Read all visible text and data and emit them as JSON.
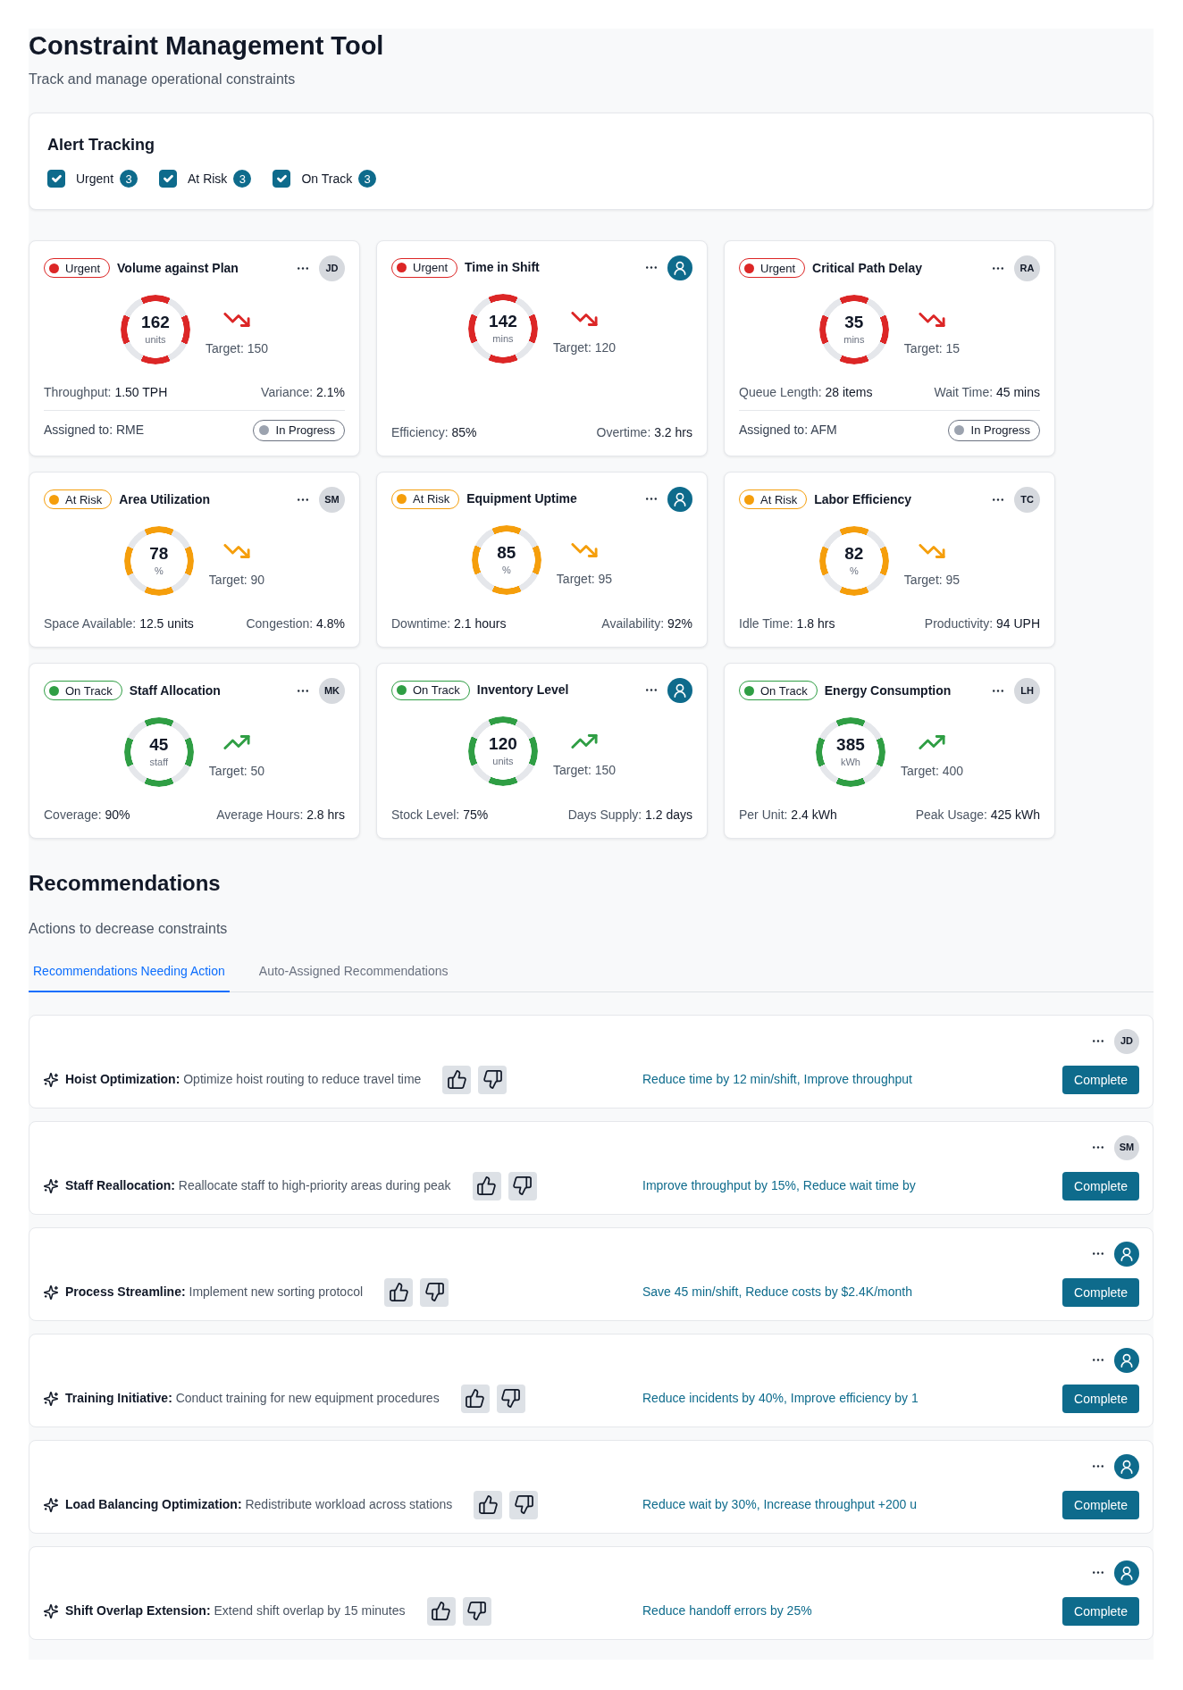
{
  "header": {
    "title": "Constraint Management Tool",
    "subtitle": "Track and manage operational constraints"
  },
  "alert_tracking": {
    "title": "Alert Tracking",
    "filters": [
      {
        "label": "Urgent",
        "checked": true,
        "count": "3"
      },
      {
        "label": "At Risk",
        "checked": true,
        "count": "3"
      },
      {
        "label": "On Track",
        "checked": true,
        "count": "3"
      }
    ]
  },
  "metric_cards": [
    {
      "status": {
        "label": "Urgent",
        "color": "#dc2626"
      },
      "title": "Volume against Plan",
      "assignee": {
        "kind": "initials",
        "initials": "JD"
      },
      "value": "162",
      "unit": "units",
      "trend": {
        "kind": "down"
      },
      "target": "Target: 150",
      "stats": [
        "Throughput: **1.50 TPH**",
        "Variance: **2.1%**"
      ],
      "assignment": {
        "text": "Assigned to: RME",
        "progress": "In Progress"
      }
    },
    {
      "status": {
        "label": "Urgent",
        "color": "#dc2626"
      },
      "title": "Time in Shift",
      "assignee": {
        "kind": "person"
      },
      "value": "142",
      "unit": "mins",
      "trend": {
        "kind": "down"
      },
      "target": "Target: 120",
      "stats": [
        "Efficiency: **85%**",
        "Overtime: **3.2 hrs**"
      ]
    },
    {
      "status": {
        "label": "Urgent",
        "color": "#dc2626"
      },
      "title": "Critical Path Delay",
      "assignee": {
        "kind": "initials",
        "initials": "RA"
      },
      "value": "35",
      "unit": "mins",
      "trend": {
        "kind": "down"
      },
      "target": "Target: 15",
      "stats": [
        "Queue Length: **28 items**",
        "Wait Time: **45 mins**"
      ],
      "assignment": {
        "text": "Assigned to: AFM",
        "progress": "In Progress"
      }
    },
    {
      "status": {
        "label": "At Risk",
        "color": "#f59e0b"
      },
      "title": "Area Utilization",
      "assignee": {
        "kind": "initials",
        "initials": "SM"
      },
      "value": "78",
      "unit": "%",
      "trend": {
        "kind": "down"
      },
      "target": "Target: 90",
      "stats": [
        "Space Available: **12.5 units**",
        "Congestion: **4.8%**"
      ]
    },
    {
      "status": {
        "label": "At Risk",
        "color": "#f59e0b"
      },
      "title": "Equipment Uptime",
      "assignee": {
        "kind": "person"
      },
      "value": "85",
      "unit": "%",
      "trend": {
        "kind": "down"
      },
      "target": "Target: 95",
      "stats": [
        "Downtime: **2.1 hours**",
        "Availability: **92%**"
      ]
    },
    {
      "status": {
        "label": "At Risk",
        "color": "#f59e0b"
      },
      "title": "Labor Efficiency",
      "assignee": {
        "kind": "initials",
        "initials": "TC"
      },
      "value": "82",
      "unit": "%",
      "trend": {
        "kind": "down"
      },
      "target": "Target: 95",
      "stats": [
        "Idle Time: **1.8 hrs**",
        "Productivity: **94 UPH**"
      ]
    },
    {
      "status": {
        "label": "On Track",
        "color": "#2f9e44"
      },
      "title": "Staff Allocation",
      "assignee": {
        "kind": "initials",
        "initials": "MK"
      },
      "value": "45",
      "unit": "staff",
      "trend": {
        "kind": "up"
      },
      "target": "Target: 50",
      "stats": [
        "Coverage: **90%**",
        "Average Hours: **2.8 hrs**"
      ]
    },
    {
      "status": {
        "label": "On Track",
        "color": "#2f9e44"
      },
      "title": "Inventory Level",
      "assignee": {
        "kind": "person"
      },
      "value": "120",
      "unit": "units",
      "trend": {
        "kind": "up"
      },
      "target": "Target: 150",
      "stats": [
        "Stock Level: **75%**",
        "Days Supply: **1.2 days**"
      ]
    },
    {
      "status": {
        "label": "On Track",
        "color": "#2f9e44"
      },
      "title": "Energy Consumption",
      "assignee": {
        "kind": "initials",
        "initials": "LH"
      },
      "value": "385",
      "unit": "kWh",
      "trend": {
        "kind": "up"
      },
      "target": "Target: 400",
      "stats": [
        "Per Unit: **2.4 kWh**",
        "Peak Usage: **425 kWh**"
      ]
    }
  ],
  "recommendations": {
    "title": "Recommendations",
    "subtitle": "Actions to decrease constraints",
    "tabs": [
      {
        "label": "Recommendations Needing Action",
        "selected": true
      },
      {
        "label": "Auto-Assigned Recommendations",
        "selected": false
      }
    ],
    "items": [
      {
        "text": "**Hoist Optimization:** Optimize hoist routing to reduce travel time",
        "impact": "Reduce time by 12 min/shift, Improve throughput",
        "assignee": {
          "kind": "initials",
          "initials": "JD"
        },
        "action": "Complete"
      },
      {
        "text": "**Staff Reallocation:** Reallocate staff to high-priority areas during peak",
        "impact": "Improve throughput by 15%, Reduce wait time by",
        "assignee": {
          "kind": "initials",
          "initials": "SM"
        },
        "action": "Complete"
      },
      {
        "text": "**Process Streamline:** Implement new sorting protocol",
        "impact": "Save 45 min/shift, Reduce costs by $2.4K/month",
        "assignee": {
          "kind": "person"
        },
        "action": "Complete"
      },
      {
        "text": "**Training Initiative:** Conduct training for new equipment procedures",
        "impact": "Reduce incidents by 40%, Improve efficiency by 1",
        "assignee": {
          "kind": "person"
        },
        "action": "Complete"
      },
      {
        "text": "**Load Balancing Optimization:** Redistribute workload across stations",
        "impact": "Reduce wait by 30%, Increase throughput +200 u",
        "assignee": {
          "kind": "person"
        },
        "action": "Complete"
      },
      {
        "text": "**Shift Overlap Extension:** Extend shift overlap by 15 minutes",
        "impact": "Reduce handoff errors by 25%",
        "assignee": {
          "kind": "person"
        },
        "action": "Complete"
      }
    ]
  }
}
